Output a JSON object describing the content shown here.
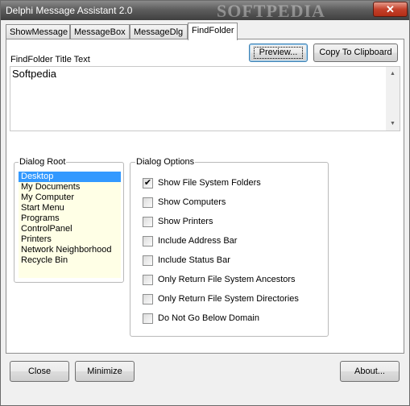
{
  "window": {
    "title": "Delphi Message Assistant 2.0",
    "watermark": "SOFTPEDIA",
    "close_glyph": "✕"
  },
  "tabs": [
    {
      "label": "ShowMessage"
    },
    {
      "label": "MessageBox"
    },
    {
      "label": "MessageDlg"
    },
    {
      "label": "FindFolder"
    }
  ],
  "findfolder": {
    "preview_label": "Preview...",
    "clipboard_label": "Copy To Clipboard",
    "title_caption": "FindFolder Title Text",
    "title_value": "Softpedia",
    "scroll_up": "▲",
    "scroll_down": "▼",
    "dialog_root": {
      "legend": "Dialog Root",
      "items": [
        "Desktop",
        "My Documents",
        "My Computer",
        "Start Menu",
        "Programs",
        "ControlPanel",
        "Printers",
        "Network Neighborhood",
        "Recycle Bin"
      ],
      "selected": "Desktop"
    },
    "dialog_options": {
      "legend": "Dialog Options",
      "options": [
        {
          "label": "Show File System Folders",
          "checked": true
        },
        {
          "label": "Show Computers",
          "checked": false
        },
        {
          "label": "Show Printers",
          "checked": false
        },
        {
          "label": "Include Address Bar",
          "checked": false
        },
        {
          "label": "Include Status Bar",
          "checked": false
        },
        {
          "label": "Only Return File System Ancestors",
          "checked": false
        },
        {
          "label": "Only Return File System Directories",
          "checked": false
        },
        {
          "label": "Do Not Go Below Domain",
          "checked": false
        }
      ]
    }
  },
  "footer": {
    "close_label": "Close",
    "minimize_label": "Minimize",
    "about_label": "About..."
  },
  "colors": {
    "selection": "#3399ff",
    "list_background": "#ffffe6",
    "close_button": "#c4412b"
  }
}
